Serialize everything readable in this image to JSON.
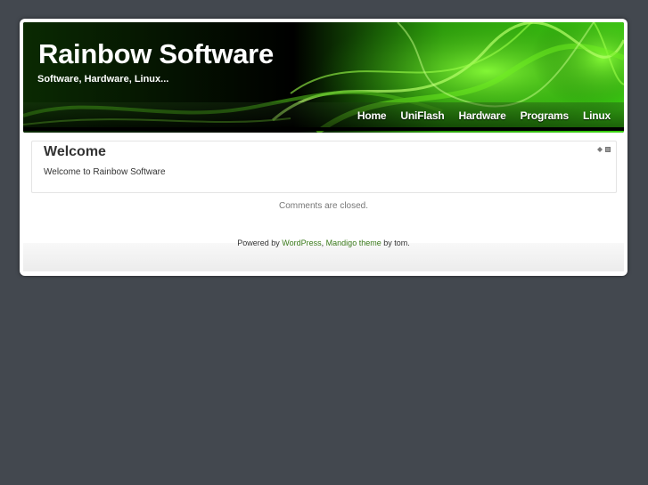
{
  "header": {
    "title": "Rainbow Software",
    "description": "Software, Hardware, Linux..."
  },
  "nav": {
    "items": [
      {
        "label": "Home"
      },
      {
        "label": "UniFlash"
      },
      {
        "label": "Hardware"
      },
      {
        "label": "Programs"
      },
      {
        "label": "Linux"
      }
    ]
  },
  "post": {
    "title": "Welcome",
    "content": "Welcome to Rainbow Software"
  },
  "comments_closed": "Comments are closed.",
  "footer": {
    "powered_by": "Powered by",
    "wordpress": "WordPress",
    "separator": ",",
    "theme": "Mandigo theme",
    "by": "by tom."
  },
  "colors": {
    "background": "#43484f",
    "accent_green": "#3a7a1a",
    "header_smoke": "#5fe01a"
  }
}
